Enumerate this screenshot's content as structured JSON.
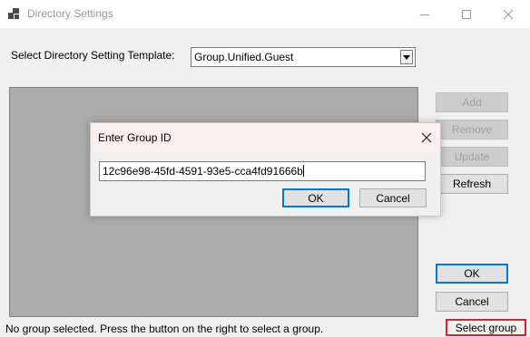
{
  "window": {
    "title": "Directory Settings",
    "icon": "app-window-icon"
  },
  "template": {
    "label": "Select Directory Setting Template:",
    "selected": "Group.Unified.Guest"
  },
  "side_buttons": {
    "add": "Add",
    "remove": "Remove",
    "update": "Update",
    "refresh": "Refresh",
    "ok": "OK",
    "cancel": "Cancel"
  },
  "status": {
    "text": "No group selected. Press the button on the right to select a group.",
    "select_group": "Select group"
  },
  "dialog": {
    "title": "Enter Group ID",
    "input_value": "12c96e98-45fd-4591-93e5-cca4fd91666b",
    "ok": "OK",
    "cancel": "Cancel"
  },
  "colors": {
    "highlight": "#d8232a",
    "focus": "#0078d7"
  }
}
